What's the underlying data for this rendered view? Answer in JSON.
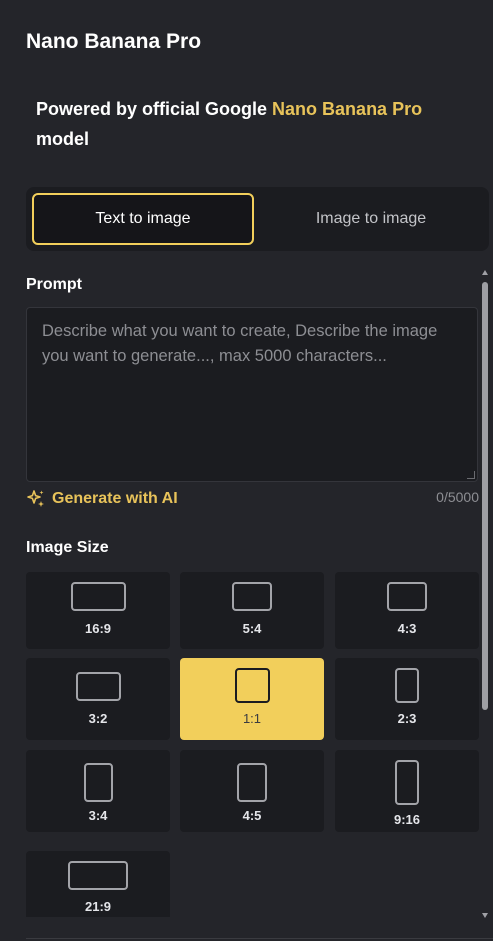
{
  "app": {
    "title": "Nano Banana Pro"
  },
  "intro": {
    "prefix": "Powered by official Google ",
    "model_name": "Nano Banana Pro",
    "suffix": "model"
  },
  "mode_tabs": [
    {
      "label": "Text to image",
      "active": true
    },
    {
      "label": "Image to image",
      "active": false
    }
  ],
  "prompt": {
    "label": "Prompt",
    "placeholder": "Describe what you want to create, Describe the image you want to generate..., max 5000 characters...",
    "value": "",
    "char_count": "0/5000",
    "generate_label": "Generate with AI"
  },
  "image_size": {
    "label": "Image Size",
    "selected": "1:1",
    "options": [
      "16:9",
      "5:4",
      "4:3",
      "3:2",
      "1:1",
      "2:3",
      "3:4",
      "4:5",
      "9:16",
      "21:9"
    ]
  },
  "colors": {
    "accent": "#f2cf5b",
    "accent_text": "#e8c35a",
    "background": "#24252a",
    "card": "#1b1c20"
  },
  "icons": {
    "generate": "sparkle-icon"
  }
}
